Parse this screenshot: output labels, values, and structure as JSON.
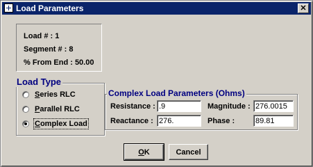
{
  "window": {
    "title": "Load Parameters",
    "close_glyph": "✕"
  },
  "info": {
    "load": "Load # : 1",
    "segment_end": "Segment # : 8",
    "from_end": "% From End : 50.00"
  },
  "load_type": {
    "title": "Load Type",
    "options": [
      {
        "label": "Series RLC",
        "accel": "S",
        "rest": "eries RLC",
        "selected": false
      },
      {
        "label": "Parallel RLC",
        "accel": "P",
        "rest": "arallel RLC",
        "selected": false
      },
      {
        "label": "Complex Load",
        "accel": "C",
        "rest": "omplex Load",
        "selected": true
      }
    ]
  },
  "complex": {
    "title": "Complex Load Parameters (Ohms)",
    "resistance_label": "Resistance :",
    "resistance_value": ".9",
    "reactance_label": "Reactance :",
    "reactance_value": "276.",
    "magnitude_label": "Magnitude :",
    "magnitude_value": "276.0015",
    "phase_label": "Phase :",
    "phase_value": "89.81"
  },
  "buttons": {
    "ok_accel": "O",
    "ok_rest": "K",
    "cancel": "Cancel"
  }
}
